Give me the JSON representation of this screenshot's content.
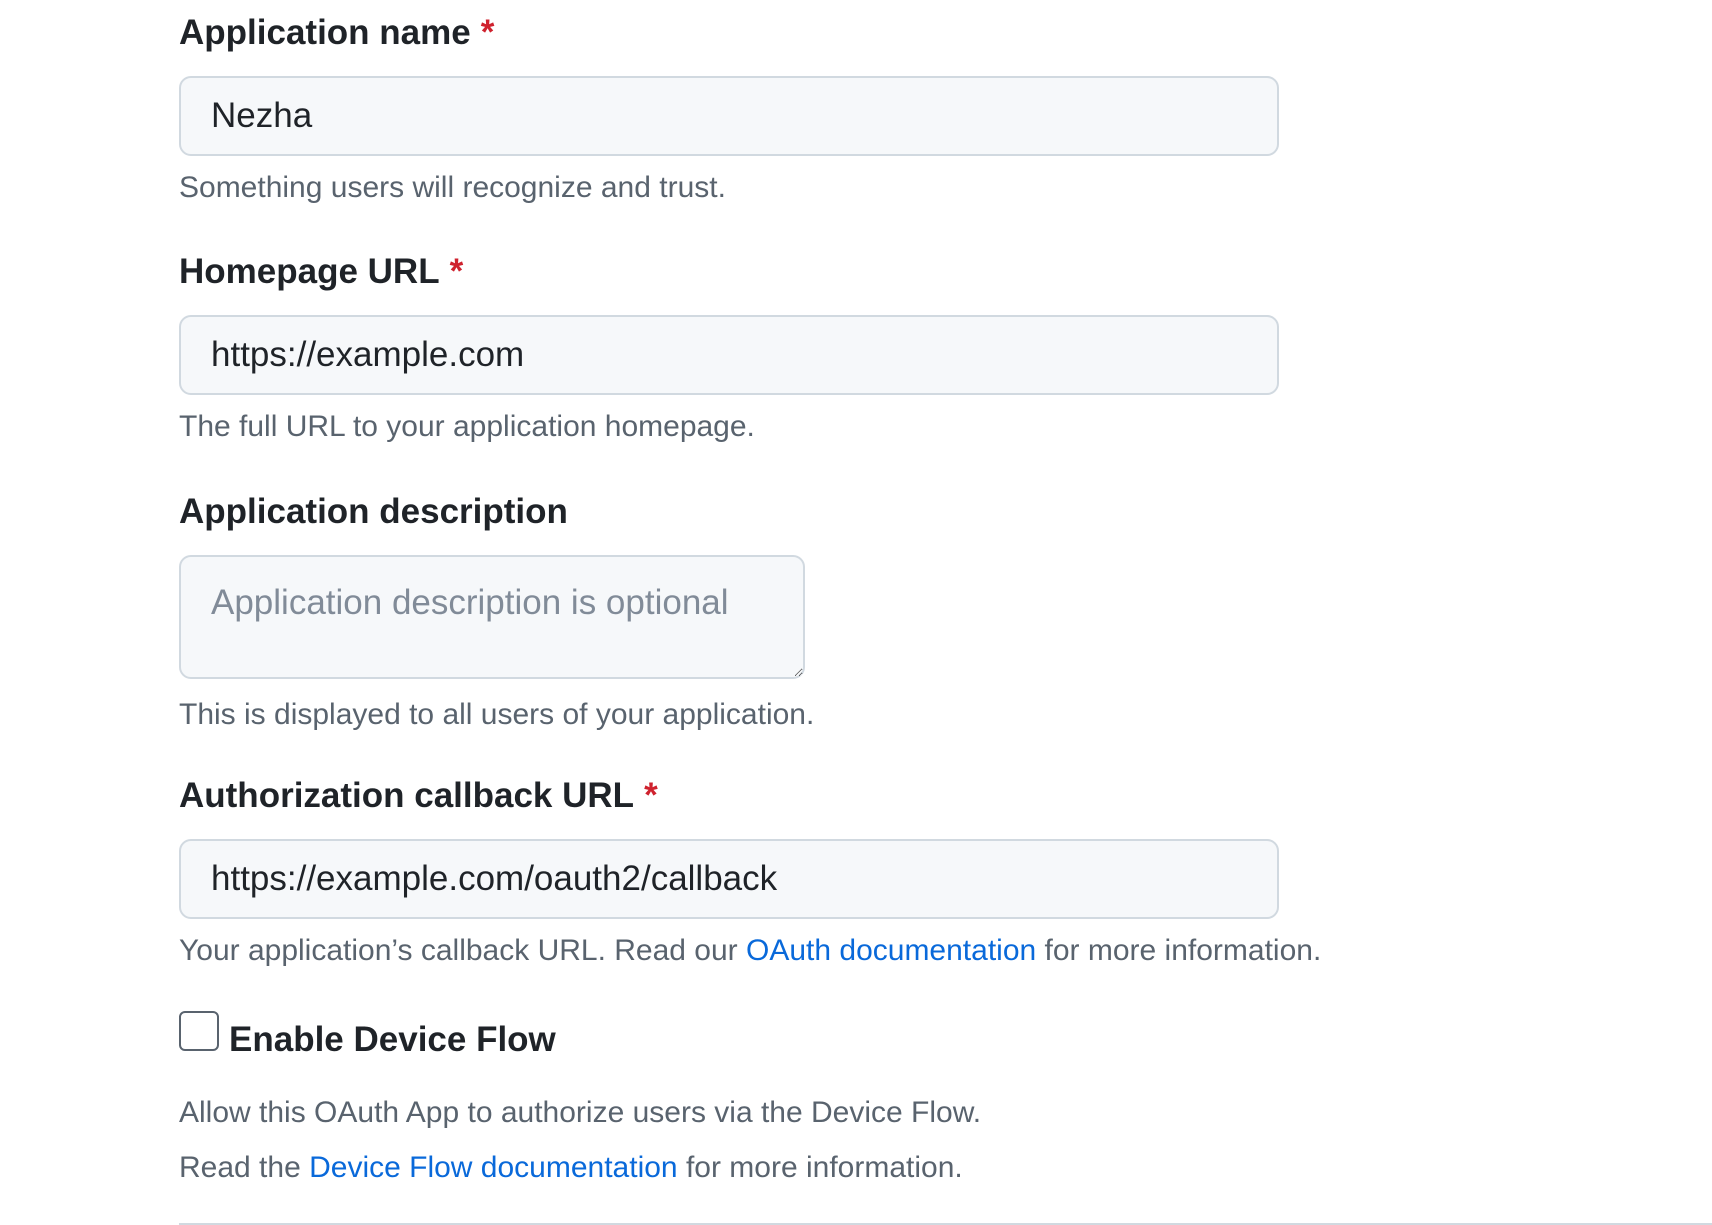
{
  "fields": {
    "app_name": {
      "label": "Application name",
      "required_mark": "*",
      "value": "Nezha",
      "note": "Something users will recognize and trust."
    },
    "homepage_url": {
      "label": "Homepage URL",
      "required_mark": "*",
      "value": "https://example.com",
      "note": "The full URL to your application homepage."
    },
    "description": {
      "label": "Application description",
      "placeholder": "Application description is optional",
      "note": "This is displayed to all users of your application."
    },
    "callback_url": {
      "label": "Authorization callback URL",
      "required_mark": "*",
      "value": "https://example.com/oauth2/callback",
      "note_prefix": "Your application’s callback URL. Read our ",
      "note_link": "OAuth documentation",
      "note_suffix": " for more information."
    }
  },
  "device_flow": {
    "checked": false,
    "label": "Enable Device Flow",
    "note_line1": "Allow this OAuth App to authorize users via the Device Flow.",
    "note_line2_prefix": "Read the ",
    "note_line2_link": "Device Flow documentation",
    "note_line2_suffix": " for more information."
  },
  "colors": {
    "required": "#cf222e",
    "link": "#0969da",
    "muted_text": "#59636e",
    "input_bg": "#f6f8fa",
    "input_border": "#d1d9e0"
  }
}
